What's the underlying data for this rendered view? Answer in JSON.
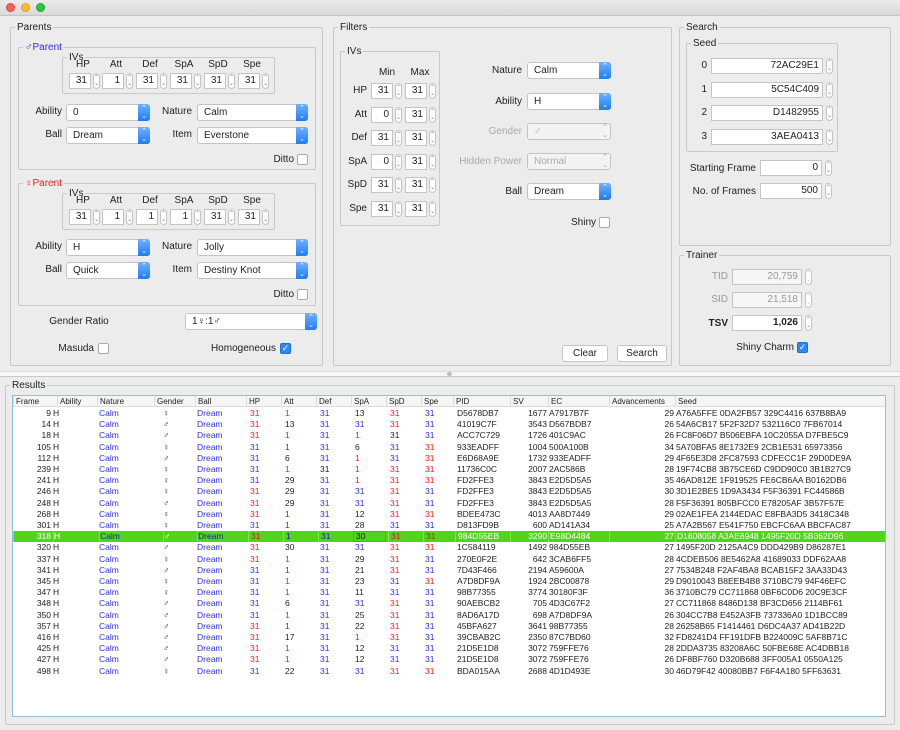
{
  "window": {
    "controls": [
      "close",
      "minimize",
      "maximize"
    ]
  },
  "parents": {
    "legend": "Parents",
    "iv_headers": [
      "HP",
      "Att",
      "Def",
      "SpA",
      "SpD",
      "Spe"
    ],
    "male": {
      "legend": "♂Parent",
      "ivs_legend": "IVs",
      "ivs": [
        "31",
        "1",
        "31",
        "31",
        "31",
        "31"
      ],
      "ability_label": "Ability",
      "ability": "0",
      "nature_label": "Nature",
      "nature": "Calm",
      "ball_label": "Ball",
      "ball": "Dream",
      "item_label": "Item",
      "item": "Everstone",
      "ditto_label": "Ditto",
      "ditto": false
    },
    "female": {
      "legend": "♀Parent",
      "ivs_legend": "IVs",
      "ivs": [
        "31",
        "1",
        "1",
        "1",
        "31",
        "31"
      ],
      "ability_label": "Ability",
      "ability": "H",
      "nature_label": "Nature",
      "nature": "Jolly",
      "ball_label": "Ball",
      "ball": "Quick",
      "item_label": "Item",
      "item": "Destiny Knot",
      "ditto_label": "Ditto",
      "ditto": false
    },
    "gender_ratio_label": "Gender Ratio",
    "gender_ratio": "1♀:1♂",
    "masuda_label": "Masuda",
    "masuda": false,
    "homogeneous_label": "Homogeneous",
    "homogeneous": true
  },
  "filters": {
    "legend": "Filters",
    "ivs_legend": "IVs",
    "min_label": "Min",
    "max_label": "Max",
    "ivs": [
      {
        "stat": "HP",
        "min": "31",
        "max": "31"
      },
      {
        "stat": "Att",
        "min": "0",
        "max": "31"
      },
      {
        "stat": "Def",
        "min": "31",
        "max": "31"
      },
      {
        "stat": "SpA",
        "min": "0",
        "max": "31"
      },
      {
        "stat": "SpD",
        "min": "31",
        "max": "31"
      },
      {
        "stat": "Spe",
        "min": "31",
        "max": "31"
      }
    ],
    "nature_label": "Nature",
    "nature": "Calm",
    "ability_label": "Ability",
    "ability": "H",
    "gender_label": "Gender",
    "gender": "♂",
    "hidden_power_label": "Hidden Power",
    "hidden_power": "Normal",
    "ball_label": "Ball",
    "ball": "Dream",
    "shiny_label": "Shiny",
    "shiny": false
  },
  "search": {
    "legend": "Search",
    "seed_legend": "Seed",
    "seeds": [
      {
        "index": "0",
        "value": "72AC29E1"
      },
      {
        "index": "1",
        "value": "5C54C409"
      },
      {
        "index": "2",
        "value": "D1482955"
      },
      {
        "index": "3",
        "value": "3AEA0413"
      }
    ],
    "starting_frame_label": "Starting Frame",
    "starting_frame": "0",
    "num_frames_label": "No. of Frames",
    "num_frames": "500"
  },
  "trainer": {
    "legend": "Trainer",
    "tid_label": "TID",
    "tid": "20,759",
    "sid_label": "SID",
    "sid": "21,518",
    "tsv_label": "TSV",
    "tsv": "1,026",
    "shiny_charm_label": "Shiny Charm",
    "shiny_charm": true
  },
  "buttons": {
    "clear": "Clear",
    "search": "Search"
  },
  "results": {
    "legend": "Results",
    "columns": [
      "Frame",
      "Ability",
      "Nature",
      "Gender",
      "Ball",
      "HP",
      "Att",
      "Def",
      "SpA",
      "SpD",
      "Spe",
      "PID",
      "SV",
      "EC",
      "Advancements",
      "Seed"
    ],
    "iv_color_legend": {
      "m": "inherited from ♂ parent",
      "f": "inherited from ♀ parent",
      "r": "random"
    },
    "selected_index": 11,
    "rows": [
      {
        "frame": "9",
        "ability": "H",
        "nature": "Calm",
        "gender": "♀",
        "ball": "Dream",
        "ivs": [
          "31",
          "1",
          "31",
          "13",
          "31",
          "31"
        ],
        "iv_src": [
          "f",
          "f",
          "m",
          "r",
          "f",
          "m"
        ],
        "pid": "D5678DB7",
        "sv": "1677",
        "ec": "A7917B7F",
        "adv": "29",
        "seed": "A76A5FFE 0DA2FB57 329C4416 637B8BA9"
      },
      {
        "frame": "14",
        "ability": "H",
        "nature": "Calm",
        "gender": "♂",
        "ball": "Dream",
        "ivs": [
          "31",
          "13",
          "31",
          "31",
          "31",
          "31"
        ],
        "iv_src": [
          "f",
          "r",
          "m",
          "m",
          "f",
          "m"
        ],
        "pid": "41019C7F",
        "sv": "3543",
        "ec": "D567BDB7",
        "adv": "26",
        "seed": "54A6CB17 5F2F32D7 532116C0 7FB67014"
      },
      {
        "frame": "18",
        "ability": "H",
        "nature": "Calm",
        "gender": "♂",
        "ball": "Dream",
        "ivs": [
          "31",
          "1",
          "31",
          "1",
          "31",
          "31"
        ],
        "iv_src": [
          "f",
          "f",
          "m",
          "f",
          "r",
          "m"
        ],
        "pid": "ACC7C729",
        "sv": "1726",
        "ec": "401C9AC",
        "adv": "26",
        "seed": "FC8F06D7 B506EBFA 10C2055A D7FBE5C9"
      },
      {
        "frame": "105",
        "ability": "H",
        "nature": "Calm",
        "gender": "♀",
        "ball": "Dream",
        "ivs": [
          "31",
          "1",
          "31",
          "6",
          "31",
          "31"
        ],
        "iv_src": [
          "m",
          "m",
          "m",
          "r",
          "m",
          "f"
        ],
        "pid": "933EADFF",
        "sv": "1004",
        "ec": "500A100B",
        "adv": "34",
        "seed": "5A70BFA5 8E1732E9 2CB1E531 65973356"
      },
      {
        "frame": "112",
        "ability": "H",
        "nature": "Calm",
        "gender": "♂",
        "ball": "Dream",
        "ivs": [
          "31",
          "6",
          "31",
          "1",
          "31",
          "31"
        ],
        "iv_src": [
          "m",
          "r",
          "m",
          "f",
          "m",
          "f"
        ],
        "pid": "E6D68A9E",
        "sv": "1732",
        "ec": "933EADFF",
        "adv": "29",
        "seed": "4F65E3D8 2FC87593 CDFECC1F 29D0DE9A"
      },
      {
        "frame": "239",
        "ability": "H",
        "nature": "Calm",
        "gender": "♀",
        "ball": "Dream",
        "ivs": [
          "31",
          "1",
          "31",
          "1",
          "31",
          "31"
        ],
        "iv_src": [
          "m",
          "f",
          "r",
          "f",
          "f",
          "f"
        ],
        "pid": "11736C0C",
        "sv": "2007",
        "ec": "2AC586B",
        "adv": "28",
        "seed": "19F74CB8 3B75CE6D C9DD90C0 3B1B27C9"
      },
      {
        "frame": "241",
        "ability": "H",
        "nature": "Calm",
        "gender": "♀",
        "ball": "Dream",
        "ivs": [
          "31",
          "29",
          "31",
          "1",
          "31",
          "31"
        ],
        "iv_src": [
          "m",
          "r",
          "m",
          "f",
          "f",
          "f"
        ],
        "pid": "FD2FFE3",
        "sv": "3843",
        "ec": "E2D5D5A5",
        "adv": "35",
        "seed": "46AD812E 1F919525 FE6CB6AA B0162DB6"
      },
      {
        "frame": "246",
        "ability": "H",
        "nature": "Calm",
        "gender": "♀",
        "ball": "Dream",
        "ivs": [
          "31",
          "29",
          "31",
          "31",
          "31",
          "31"
        ],
        "iv_src": [
          "f",
          "r",
          "m",
          "m",
          "f",
          "m"
        ],
        "pid": "FD2FFE3",
        "sv": "3843",
        "ec": "E2D5D5A5",
        "adv": "30",
        "seed": "3D1E2BE5 1D9A3434 F5F36391 FC44586B"
      },
      {
        "frame": "248",
        "ability": "H",
        "nature": "Calm",
        "gender": "♂",
        "ball": "Dream",
        "ivs": [
          "31",
          "29",
          "31",
          "31",
          "31",
          "31"
        ],
        "iv_src": [
          "f",
          "r",
          "m",
          "m",
          "f",
          "m"
        ],
        "pid": "FD2FFE3",
        "sv": "3843",
        "ec": "E2D5D5A5",
        "adv": "28",
        "seed": "F5F36391 805BFCC0 E78205AF 3B57F57E"
      },
      {
        "frame": "268",
        "ability": "H",
        "nature": "Calm",
        "gender": "♀",
        "ball": "Dream",
        "ivs": [
          "31",
          "1",
          "31",
          "12",
          "31",
          "31"
        ],
        "iv_src": [
          "f",
          "m",
          "m",
          "r",
          "f",
          "f"
        ],
        "pid": "BDEE473C",
        "sv": "4013",
        "ec": "AA8D7449",
        "adv": "29",
        "seed": "02AE1FEA 2144EDAC E8FBA3D5 3418C348"
      },
      {
        "frame": "301",
        "ability": "H",
        "nature": "Calm",
        "gender": "♀",
        "ball": "Dream",
        "ivs": [
          "31",
          "1",
          "31",
          "28",
          "31",
          "31"
        ],
        "iv_src": [
          "m",
          "m",
          "m",
          "r",
          "m",
          "m"
        ],
        "pid": "D813FD9B",
        "sv": "600",
        "ec": "AD141A34",
        "adv": "25",
        "seed": "A7A2B567 E541F750 EBCFC6AA BBCFAC87"
      },
      {
        "frame": "318",
        "ability": "H",
        "nature": "Calm",
        "gender": "♂",
        "ball": "Dream",
        "ivs": [
          "31",
          "1",
          "31",
          "30",
          "31",
          "31"
        ],
        "iv_src": [
          "f",
          "m",
          "m",
          "r",
          "f",
          "f"
        ],
        "pid": "984D55EB",
        "sv": "3290",
        "ec": "E98D4484",
        "adv": "27",
        "seed": "D1808058 A3AE8948 1495F20D 5B362D96"
      },
      {
        "frame": "320",
        "ability": "H",
        "nature": "Calm",
        "gender": "♂",
        "ball": "Dream",
        "ivs": [
          "31",
          "30",
          "31",
          "31",
          "31",
          "31"
        ],
        "iv_src": [
          "f",
          "r",
          "m",
          "m",
          "f",
          "f"
        ],
        "pid": "1C584119",
        "sv": "1492",
        "ec": "984D55EB",
        "adv": "27",
        "seed": "1495F20D 2125A4C9 DDD429B9 D86287E1"
      },
      {
        "frame": "337",
        "ability": "H",
        "nature": "Calm",
        "gender": "♀",
        "ball": "Dream",
        "ivs": [
          "31",
          "1",
          "31",
          "29",
          "31",
          "31"
        ],
        "iv_src": [
          "f",
          "f",
          "m",
          "r",
          "f",
          "m"
        ],
        "pid": "270E0F2E",
        "sv": "642",
        "ec": "3CAB6FF5",
        "adv": "28",
        "seed": "4CDEB506 8E5462A8 41689033 DDF62AA8"
      },
      {
        "frame": "341",
        "ability": "H",
        "nature": "Calm",
        "gender": "♂",
        "ball": "Dream",
        "ivs": [
          "31",
          "1",
          "31",
          "21",
          "31",
          "31"
        ],
        "iv_src": [
          "m",
          "m",
          "m",
          "r",
          "f",
          "m"
        ],
        "pid": "7D43F466",
        "sv": "2194",
        "ec": "A59600A",
        "adv": "27",
        "seed": "7534B248 F2AF4BA8 BCAB15F2 3AA33D43"
      },
      {
        "frame": "345",
        "ability": "H",
        "nature": "Calm",
        "gender": "♀",
        "ball": "Dream",
        "ivs": [
          "31",
          "1",
          "31",
          "23",
          "31",
          "31"
        ],
        "iv_src": [
          "m",
          "f",
          "m",
          "r",
          "m",
          "f"
        ],
        "pid": "A7D8DF9A",
        "sv": "1924",
        "ec": "2BC00878",
        "adv": "29",
        "seed": "D9010043 B8EEB4B8 3710BC79 94F46EFC"
      },
      {
        "frame": "347",
        "ability": "H",
        "nature": "Calm",
        "gender": "♀",
        "ball": "Dream",
        "ivs": [
          "31",
          "1",
          "31",
          "11",
          "31",
          "31"
        ],
        "iv_src": [
          "m",
          "f",
          "m",
          "r",
          "m",
          "m"
        ],
        "pid": "98B77355",
        "sv": "3774",
        "ec": "30180F3F",
        "adv": "36",
        "seed": "3710BC79 CC711868 0BF6C0D6 20C9E3CF"
      },
      {
        "frame": "348",
        "ability": "H",
        "nature": "Calm",
        "gender": "♂",
        "ball": "Dream",
        "ivs": [
          "31",
          "6",
          "31",
          "31",
          "31",
          "31"
        ],
        "iv_src": [
          "m",
          "r",
          "m",
          "m",
          "f",
          "m"
        ],
        "pid": "90AEBCB2",
        "sv": "705",
        "ec": "4D3C67F2",
        "adv": "27",
        "seed": "CC711868 8486D138 BF3CD656 2114BF61"
      },
      {
        "frame": "350",
        "ability": "H",
        "nature": "Calm",
        "gender": "♂",
        "ball": "Dream",
        "ivs": [
          "31",
          "1",
          "31",
          "25",
          "31",
          "31"
        ],
        "iv_src": [
          "m",
          "f",
          "m",
          "r",
          "f",
          "m"
        ],
        "pid": "8AD6A17D",
        "sv": "698",
        "ec": "A7D8DF9A",
        "adv": "26",
        "seed": "304CC7B8 E452A3FB 737336A0 1D1BCC89"
      },
      {
        "frame": "357",
        "ability": "H",
        "nature": "Calm",
        "gender": "♂",
        "ball": "Dream",
        "ivs": [
          "31",
          "1",
          "31",
          "22",
          "31",
          "31"
        ],
        "iv_src": [
          "f",
          "m",
          "m",
          "r",
          "f",
          "m"
        ],
        "pid": "45BFA627",
        "sv": "3641",
        "ec": "98B77355",
        "adv": "28",
        "seed": "26258B65 F1414461 D6DC4A37 AD41B22D"
      },
      {
        "frame": "416",
        "ability": "H",
        "nature": "Calm",
        "gender": "♂",
        "ball": "Dream",
        "ivs": [
          "31",
          "17",
          "31",
          "1",
          "31",
          "31"
        ],
        "iv_src": [
          "f",
          "r",
          "m",
          "f",
          "f",
          "m"
        ],
        "pid": "39CBAB2C",
        "sv": "2350",
        "ec": "87C7BD60",
        "adv": "32",
        "seed": "FD8241D4 FF191DFB B224009C 5AF8B71C"
      },
      {
        "frame": "425",
        "ability": "H",
        "nature": "Calm",
        "gender": "♂",
        "ball": "Dream",
        "ivs": [
          "31",
          "1",
          "31",
          "12",
          "31",
          "31"
        ],
        "iv_src": [
          "f",
          "f",
          "m",
          "r",
          "m",
          "m"
        ],
        "pid": "21D5E1D8",
        "sv": "3072",
        "ec": "759FFE76",
        "adv": "28",
        "seed": "2DDA3735 83208A6C 50FBE68E AC4DBB18"
      },
      {
        "frame": "427",
        "ability": "H",
        "nature": "Calm",
        "gender": "♂",
        "ball": "Dream",
        "ivs": [
          "31",
          "1",
          "31",
          "12",
          "31",
          "31"
        ],
        "iv_src": [
          "f",
          "f",
          "m",
          "r",
          "m",
          "m"
        ],
        "pid": "21D5E1D8",
        "sv": "3072",
        "ec": "759FFE76",
        "adv": "26",
        "seed": "DF8BF760 D320B688 3FF005A1 0550A125"
      },
      {
        "frame": "498",
        "ability": "H",
        "nature": "Calm",
        "gender": "♀",
        "ball": "Dream",
        "ivs": [
          "31",
          "22",
          "31",
          "31",
          "31",
          "31"
        ],
        "iv_src": [
          "m",
          "r",
          "m",
          "m",
          "f",
          "f"
        ],
        "pid": "BDA015AA",
        "sv": "2688",
        "ec": "4D1D493E",
        "adv": "30",
        "seed": "46D79F42 40080BB7 F6F4A180 5FF63631"
      }
    ]
  }
}
